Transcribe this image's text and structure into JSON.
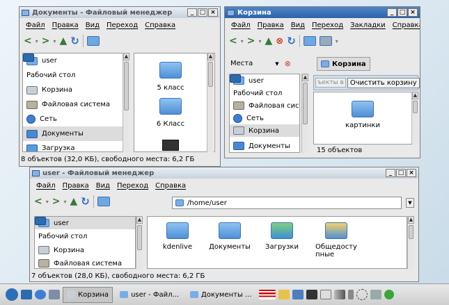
{
  "colors": {
    "title_active": "#2d63a8",
    "accent": "#4a89d1"
  },
  "menu": [
    "Файл",
    "Правка",
    "Вид",
    "Переход",
    "Справка"
  ],
  "menu_trash": [
    "Файл",
    "Правка",
    "Вид",
    "Переход",
    "Закладки",
    "Справка"
  ],
  "win_docs": {
    "title": "Документы - Файловый менеджер",
    "side": [
      "user",
      "Рабочий стол",
      "Корзина",
      "Файловая система",
      "Сеть",
      "Документы",
      "Загрузка"
    ],
    "files": [
      "5 класс",
      "6 Класс"
    ],
    "status": "8 объектов (32,0 КБ), свободного места: 6,2 ГБ"
  },
  "win_trash": {
    "title": "Корзина",
    "places_label": "Места",
    "location": "Корзина",
    "side": [
      "user",
      "Рабочий стол",
      "Файловая сис...",
      "Сеть",
      "Корзина",
      "Документы"
    ],
    "tab_partial": "ъекты в",
    "clear_button": "Очистить корзину",
    "files": [
      "картинки"
    ],
    "status": "15 объектов"
  },
  "win_user": {
    "title": "user - Файловый менеджер",
    "path": "/home/user",
    "side": [
      "user",
      "Рабочий стол",
      "Корзина",
      "Файловая система"
    ],
    "files": [
      "kdenlive",
      "Документы",
      "Загрузки",
      "Общедосту\nпные"
    ],
    "status": "7 объектов (28,0 КБ), свободного места: 6,2 ГБ"
  },
  "taskbar": {
    "items": [
      "Корзина",
      "user - Файл...",
      "Документы ..."
    ]
  },
  "window_buttons": {
    "min": "_",
    "max": "□",
    "close": "×"
  }
}
